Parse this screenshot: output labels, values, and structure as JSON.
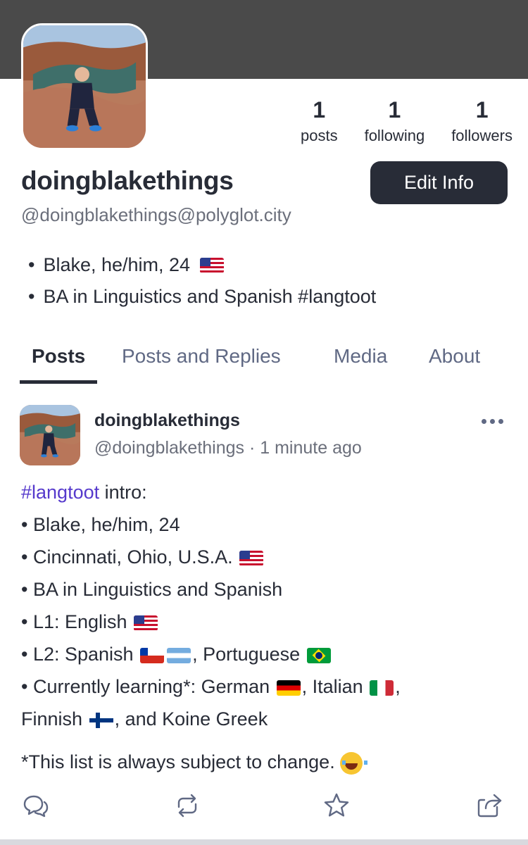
{
  "profile": {
    "stats": [
      {
        "count": "1",
        "label": "posts"
      },
      {
        "count": "1",
        "label": "following"
      },
      {
        "count": "1",
        "label": "followers"
      }
    ],
    "display_name": "doingblakethings",
    "handle": "@doingblakethings@polyglot.city",
    "edit_button_label": "Edit Info",
    "bio": [
      {
        "text": "Blake, he/him, 24",
        "flags": [
          "us"
        ]
      },
      {
        "text": "BA in Linguistics and Spanish #langtoot",
        "flags": []
      }
    ]
  },
  "tabs": [
    {
      "label": "Posts",
      "active": true
    },
    {
      "label": "Posts and Replies",
      "active": false
    },
    {
      "label": "Media",
      "active": false
    },
    {
      "label": "About",
      "active": false
    }
  ],
  "post": {
    "author_name": "doingblakethings",
    "meta": "@doingblakethings · 1 minute ago",
    "hashtag": "#langtoot",
    "intro_suffix": " intro:",
    "lines": {
      "l1": "Blake, he/him, 24",
      "l2": "Cincinnati, Ohio, U.S.A.",
      "l3": "BA in Linguistics and Spanish",
      "l4": "L1: English",
      "l5a": "L2: Spanish",
      "l5b": ", Portuguese",
      "l6a": "Currently learning*: German",
      "l6b": ", Italian",
      "l6c": ",",
      "l7a": "Finnish",
      "l7b": ", and Koine Greek"
    },
    "footnote": "*This list is always subject to change.",
    "bullet": "•"
  },
  "actions": [
    {
      "name": "reply-icon"
    },
    {
      "name": "boost-icon"
    },
    {
      "name": "favourite-icon"
    },
    {
      "name": "share-icon"
    }
  ],
  "colors": {
    "banner": "#4a4a4a",
    "text": "#282c37",
    "muted": "#6b6f7b",
    "hashtag": "#563acc",
    "button": "#282c37"
  }
}
